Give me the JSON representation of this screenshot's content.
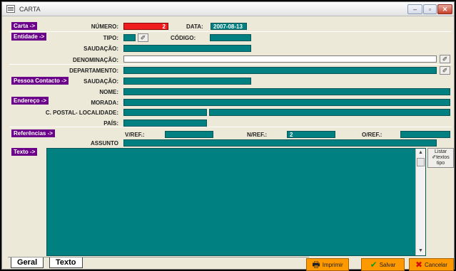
{
  "window": {
    "title": "CARTA",
    "min_label": "–",
    "max_label": "▫",
    "close_label": "✕"
  },
  "header": {
    "carta_label": "Carta ->",
    "numero_label": "NÚMERO:",
    "numero_value": "2",
    "data_label": "DATA:",
    "data_value": "2007-08-13"
  },
  "entidade": {
    "section_label": "Entidade ->",
    "tipo_label": "TIPO:",
    "codigo_label": "CÓDIGO:",
    "saudacao_label": "SAUDAÇÃO:",
    "denominacao_label": "DENOMINAÇÃO:",
    "departamento_label": "DEPARTAMENTO:",
    "pick_glyph": "✐"
  },
  "contacto": {
    "section_label": "Pessoa Contacto ->",
    "saudacao_label": "SAUDAÇÃO:",
    "nome_label": "NOME:"
  },
  "endereco": {
    "section_label": "Endereço ->",
    "morada_label": "MORADA:",
    "cpostal_label": "C. POSTAL- LOCALIDADE:",
    "pais_label": "PAÍS:"
  },
  "referencias": {
    "section_label": "Referências ->",
    "vref_label": "V/REF.:",
    "nref_label": "N/REF.:",
    "nref_value": "2",
    "oref_label": "O/REF.:",
    "assunto_label": "ASSUNTO"
  },
  "texto": {
    "section_label": "Texto ->",
    "listar_label_1": "Listar",
    "listar_label_2": "textos",
    "listar_label_3": "tipo",
    "scroll_up": "▲",
    "scroll_down": "▼"
  },
  "tabs": [
    {
      "label": "Geral"
    },
    {
      "label": "Texto"
    }
  ],
  "actions": {
    "imprimir": "Imprimir",
    "salvar": "Salvar",
    "cancelar": "Cancelar",
    "imprimir_icon": "🖶",
    "salvar_icon": "✔",
    "cancelar_icon": "✖"
  }
}
